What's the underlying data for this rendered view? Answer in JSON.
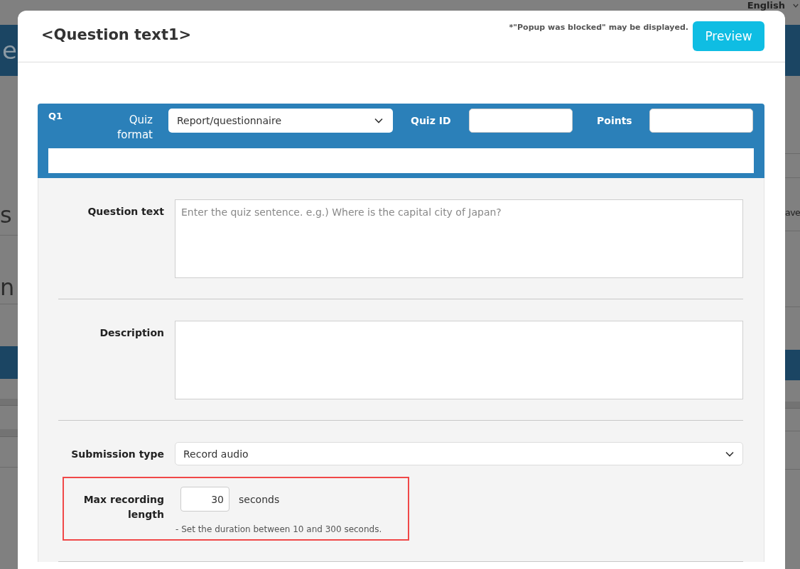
{
  "background": {
    "language": "English",
    "banner_text": "e",
    "left_texts": [
      "s",
      "n"
    ],
    "right_text": "ave"
  },
  "dialog": {
    "title": "<Question text1>",
    "note": "*\"Popup was blocked\" may be displayed.",
    "preview_button": "Preview"
  },
  "question": {
    "number": "Q1",
    "format_label": "Quiz format",
    "format_value": "Report/questionnaire",
    "id_label": "Quiz ID",
    "points_label": "Points"
  },
  "sections": [
    {
      "fields": [
        {
          "kind": "textarea",
          "label": "Question text",
          "placeholder": "Enter the quiz sentence. e.g.) Where is the capital city of Japan?",
          "highlighted": false
        }
      ]
    },
    {
      "fields": [
        {
          "kind": "textarea",
          "label": "Description",
          "highlighted": false
        }
      ]
    },
    {
      "fields": [
        {
          "kind": "select",
          "label": "Submission type",
          "value": "Record audio",
          "highlighted": false
        },
        {
          "kind": "number",
          "label": "Max recording length",
          "value": "30",
          "unit": "seconds",
          "hint": "- Set the duration between 10 and 300 seconds.",
          "highlighted": true
        }
      ]
    }
  ]
}
